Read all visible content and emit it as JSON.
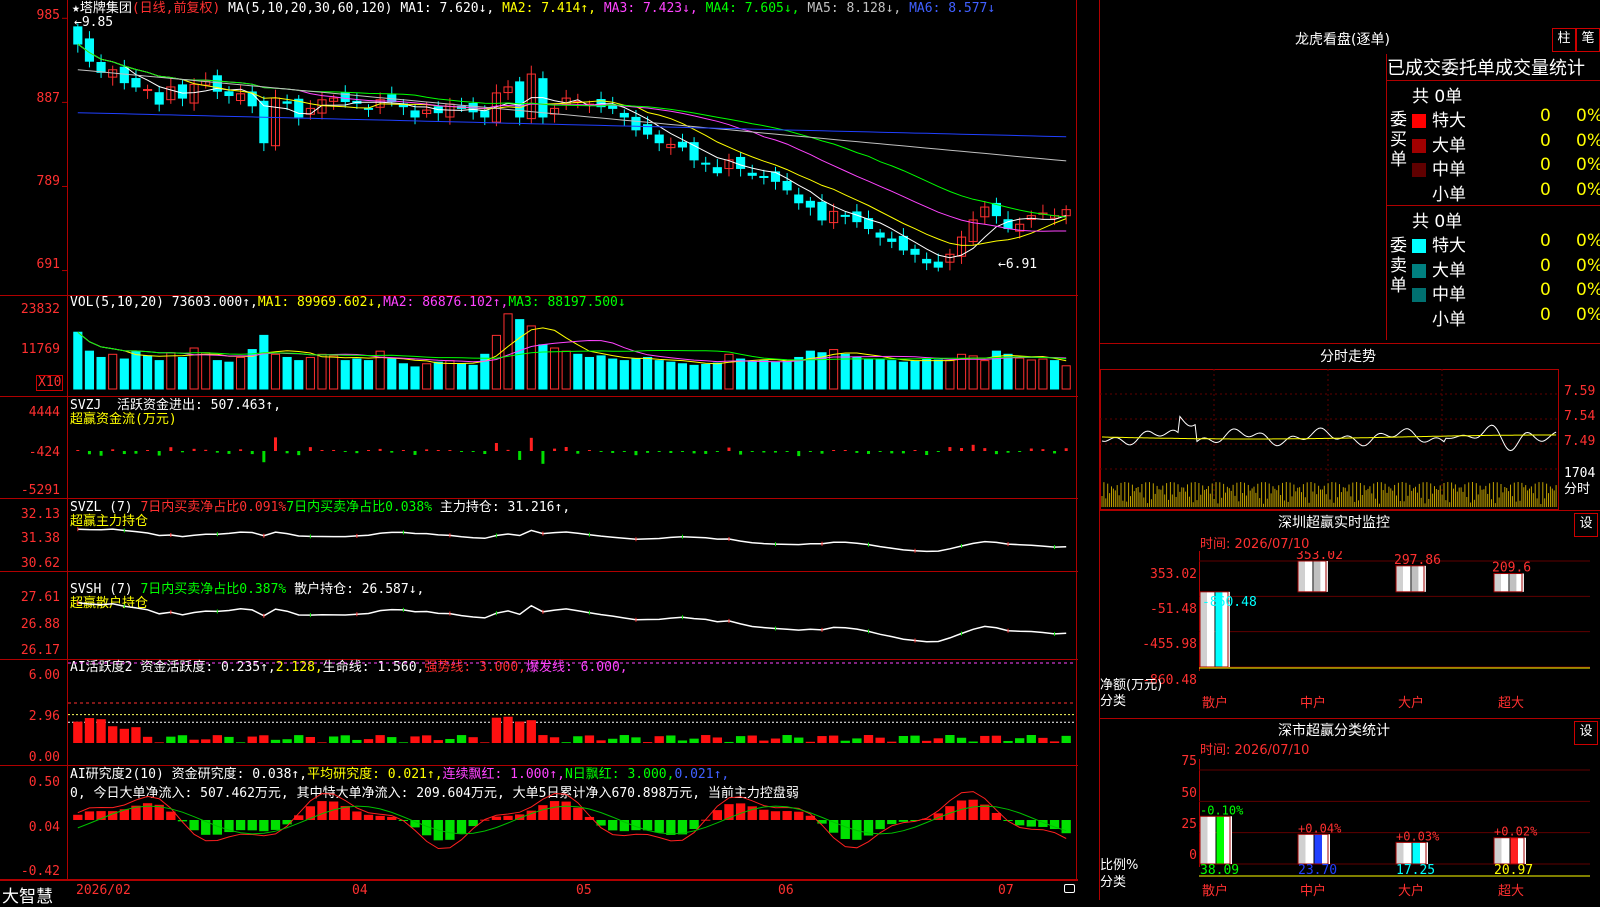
{
  "main": {
    "title": "★塔牌集团",
    "period_label": "(日线,前复权)",
    "ma_indicator": "MA(5,10,20,30,60,120)",
    "ma1": "MA1: 7.620↓,",
    "ma2": "MA2: 7.414↑,",
    "ma3": "MA3: 7.423↓,",
    "ma4": "MA4: 7.605↓,",
    "ma5": "MA5: 8.128↓,",
    "ma6": "MA6: 8.577↓",
    "high_marker": "←9.85",
    "low_marker": "←6.91",
    "y_ticks": [
      "985",
      "887",
      "789",
      "691"
    ]
  },
  "vol": {
    "header": "VOL(5,10,20)",
    "value": "73603.000↑,",
    "ma1": "MA1: 89969.602↓,",
    "ma2": "MA2: 86876.102↑,",
    "ma3": "MA3: 88197.500↓",
    "y_ticks": [
      "23832",
      "11769"
    ],
    "unit": "X10"
  },
  "svzj": {
    "header": "SVZJ",
    "line1": "活跃资金进出: 507.463↑,",
    "line2": "超赢资金流(万元)",
    "y_ticks": [
      "4444",
      "-424",
      "-5291"
    ]
  },
  "svzl": {
    "header": "SVZL (7)",
    "a": "7日内买卖净占比0.091%",
    "b": "7日内买卖净占比0.038%",
    "c": "主力持仓: 31.216↑,",
    "line2": "超赢主力持仓",
    "y_ticks": [
      "32.13",
      "31.38",
      "30.62"
    ]
  },
  "svsh": {
    "header": "SVSH (7)",
    "a": "7日内买卖净占比0.387%",
    "c": "散户持仓: 26.587↓,",
    "line2": "超赢散户持仓",
    "y_ticks": [
      "27.61",
      "26.88",
      "26.17"
    ]
  },
  "ai1": {
    "header": "AI活跃度2",
    "a": "资金活跃度: 0.235↑,",
    "b": "2.128,",
    "c": "生命线: 1.560,",
    "d": "强势线: 3.000,",
    "e": "爆发线: 6.000,",
    "y_ticks": [
      "6.00",
      "2.96",
      "0.00"
    ]
  },
  "ai2": {
    "header": "AI研究度2(10)",
    "a": "资金研究度: 0.038↑,",
    "b": "平均研究度: 0.021↑,",
    "c": "连续飘红: 1.000↑,",
    "d": "N日飘红: 3.000,",
    "e": "0.021↑,",
    "line2": "0, 今日大单净流入: 507.462万元, 其中特大单净流入: 209.604万元, 大单5日累计净入670.898万元, 当前主力控盘弱",
    "y_ticks": [
      "0.50",
      "0.04",
      "-0.42"
    ]
  },
  "xaxis": {
    "brand": "大智慧",
    "labels": [
      "2026/02",
      "04",
      "05",
      "06",
      "07"
    ]
  },
  "dragon": {
    "title": "龙虎看盘(逐单)",
    "btn1": "柱",
    "btn2": "笔",
    "tabs": "已成交委托单成交量统计",
    "buy_label": "委买单",
    "sell_label": "委卖单",
    "buy_total": "共 0单",
    "sell_total": "共 0单",
    "buy_rows": [
      {
        "label": "特大",
        "count": "0",
        "pct": "0%",
        "color": "#ff0000"
      },
      {
        "label": "大单",
        "count": "0",
        "pct": "0%",
        "color": "#a00000"
      },
      {
        "label": "中单",
        "count": "0",
        "pct": "0%",
        "color": "#600000"
      },
      {
        "label": "小单",
        "count": "0",
        "pct": "0%",
        "color": "#000000"
      }
    ],
    "sell_rows": [
      {
        "label": "特大",
        "count": "0",
        "pct": "0%",
        "color": "#00ffff"
      },
      {
        "label": "大单",
        "count": "0",
        "pct": "0%",
        "color": "#008080"
      },
      {
        "label": "中单",
        "count": "0",
        "pct": "0%",
        "color": "#007070"
      },
      {
        "label": "小单",
        "count": "0",
        "pct": "0%",
        "color": "#000000"
      }
    ]
  },
  "intraday": {
    "title": "分时走势",
    "y_ticks": [
      "7.59",
      "7.54",
      "7.49"
    ],
    "vol_label": "1704",
    "vol_unit": "分时"
  },
  "shenzhen_monitor": {
    "title": "深圳超赢实时监控",
    "settings": "设",
    "time": "时间: 2026/07/10",
    "y_ticks": [
      "353.02",
      "-51.48",
      "-455.98",
      "-860.48"
    ],
    "y_title": "净额(万元)",
    "x_title": "分类",
    "categories": [
      "散户",
      "中户",
      "大户",
      "超大"
    ],
    "values": [
      -860.48,
      353.02,
      297.86,
      209.6
    ],
    "value_labels": [
      "-860.48",
      "353.02",
      "297.86",
      "209.6"
    ]
  },
  "shenzhen_class": {
    "title": "深市超赢分类统计",
    "settings": "设",
    "time": "时间: 2026/07/10",
    "y_ticks": [
      "75",
      "50",
      "25",
      "0"
    ],
    "y_title": "比例%",
    "x_title": "分类",
    "categories": [
      "散户",
      "中户",
      "大户",
      "超大"
    ],
    "values": [
      38.09,
      23.7,
      17.25,
      20.97
    ],
    "value_labels": [
      "38.09",
      "23.70",
      "17.25",
      "20.97"
    ],
    "change_labels": [
      "-0.10%",
      "+0.04%",
      "+0.03%",
      "+0.02%"
    ]
  },
  "chart_data": [
    {
      "type": "candlestick",
      "title": "塔牌集团 (日线,前复权)",
      "ylim": [
        6.8,
        9.9
      ],
      "y_ticks": [
        9.85,
        8.87,
        7.89,
        6.91
      ],
      "high_low_marks": {
        "high": 9.85,
        "low": 6.91
      },
      "ma_values": {
        "MA1": 7.62,
        "MA2": 7.414,
        "MA3": 7.423,
        "MA4": 7.605,
        "MA5": 8.128,
        "MA6": 8.577
      },
      "close": [
        9.55,
        9.35,
        9.22,
        9.25,
        9.1,
        9.05,
        9.02,
        8.85,
        9.05,
        8.92,
        9.08,
        9.12,
        9.0,
        8.95,
        8.97,
        8.83,
        8.4,
        8.92,
        8.86,
        8.7,
        8.8,
        8.9,
        8.92,
        8.88,
        8.86,
        8.8,
        8.9,
        8.88,
        8.82,
        8.7,
        8.78,
        8.75,
        8.85,
        8.8,
        8.76,
        8.7,
        8.98,
        9.05,
        8.7,
        9.2,
        8.7,
        8.8,
        8.92,
        8.88,
        8.85,
        8.82,
        8.8,
        8.7,
        8.55,
        8.5,
        8.4,
        8.38,
        8.35,
        8.2,
        8.15,
        8.05,
        8.2,
        8.1,
        8.02,
        8.0,
        7.95,
        7.85,
        7.7,
        7.65,
        7.5,
        7.6,
        7.55,
        7.48,
        7.4,
        7.3,
        7.25,
        7.15,
        7.1,
        7.0,
        6.95,
        7.1,
        7.3,
        7.5,
        7.65,
        7.55,
        7.4,
        7.45,
        7.55,
        7.58,
        7.55,
        7.62
      ],
      "volume": [
        18000,
        12000,
        10000,
        11000,
        9500,
        12000,
        10500,
        9000,
        11500,
        10000,
        13000,
        11500,
        9000,
        8500,
        10000,
        12500,
        17000,
        11000,
        10000,
        9000,
        10000,
        11000,
        10500,
        9000,
        9500,
        9000,
        12000,
        9500,
        8000,
        7000,
        8000,
        8500,
        9000,
        8000,
        7500,
        11000,
        17000,
        23832,
        22000,
        20000,
        14000,
        13000,
        12000,
        11000,
        10000,
        10500,
        9500,
        9000,
        9500,
        10000,
        9000,
        8500,
        8000,
        7500,
        7800,
        8200,
        11000,
        9500,
        8700,
        9000,
        8500,
        8800,
        10000,
        12000,
        11500,
        12500,
        11000,
        10000,
        9500,
        9200,
        9000,
        8500,
        8800,
        9500,
        9200,
        9000,
        11000,
        10500,
        9000,
        12000,
        11000,
        9800,
        9200,
        9500,
        9000,
        7360
      ]
    },
    {
      "type": "bar",
      "title": "超赢资金流(万元)",
      "ylim": [
        -5291,
        4444
      ],
      "last_value": 507.463
    },
    {
      "type": "line",
      "title": "超赢主力持仓",
      "ylim": [
        30.62,
        32.13
      ],
      "last_value": 31.216
    },
    {
      "type": "line",
      "title": "超赢散户持仓",
      "ylim": [
        26.17,
        27.61
      ],
      "last_value": 26.587
    },
    {
      "type": "bar",
      "title": "AI活跃度2",
      "ylim": [
        0,
        6.0
      ],
      "lines": {
        "生命线": 1.56,
        "强势线": 3.0,
        "爆发线": 6.0
      },
      "last_value": 0.235
    },
    {
      "type": "bar",
      "title": "AI研究度2(10)",
      "ylim": [
        -0.42,
        0.5
      ],
      "last_value": 0.038,
      "average": 0.021
    },
    {
      "type": "bar",
      "title": "深圳超赢实时监控",
      "categories": [
        "散户",
        "中户",
        "大户",
        "超大"
      ],
      "values": [
        -860.48,
        353.02,
        297.86,
        209.6
      ],
      "ylabel": "净额(万元)",
      "xlabel": "分类",
      "ylim": [
        -860.48,
        353.02
      ]
    },
    {
      "type": "bar",
      "title": "深市超赢分类统计",
      "categories": [
        "散户",
        "中户",
        "大户",
        "超大"
      ],
      "values": [
        38.09,
        23.7,
        17.25,
        20.97
      ],
      "changes": [
        "-0.10%",
        "+0.04%",
        "+0.03%",
        "+0.02%"
      ],
      "ylabel": "比例%",
      "xlabel": "分类",
      "ylim": [
        0,
        75
      ]
    }
  ],
  "colors": {
    "up": "#ff3030",
    "down": "#00ffff",
    "ma1": "#ffffff",
    "ma2": "#ffff00",
    "ma3": "#ff44ff",
    "ma4": "#00ff00",
    "ma5": "#c0c0c0",
    "ma6": "#2040ff",
    "frame": "#b00000"
  }
}
